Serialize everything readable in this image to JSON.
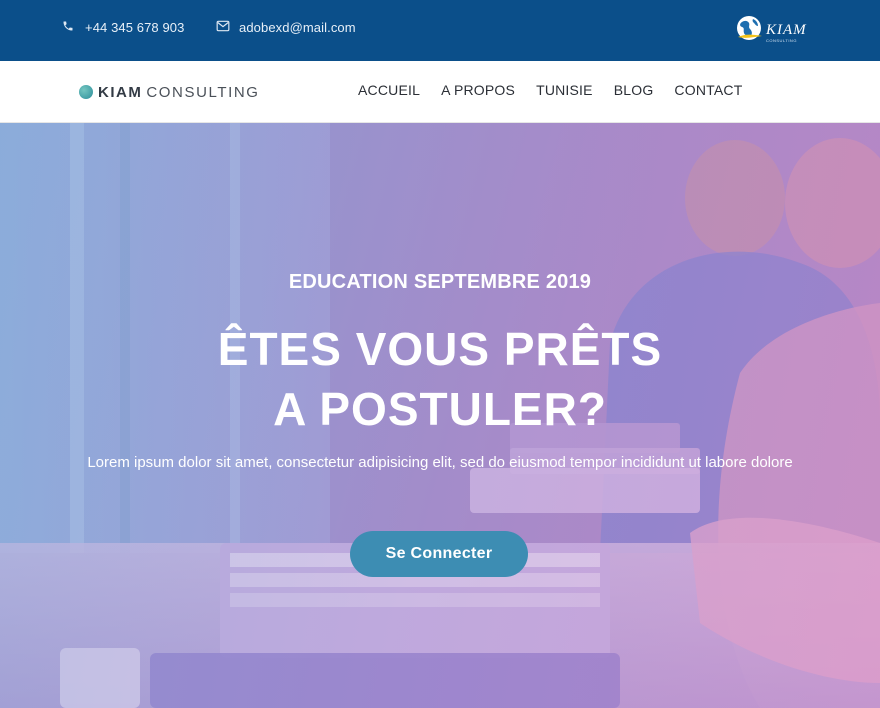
{
  "topbar": {
    "phone": "+44 345 678 903",
    "email": "adobexd@mail.com",
    "badge_text": "KIAM",
    "badge_sub": "CONSULTING",
    "background": "#0b4f8a"
  },
  "navbar": {
    "logo_strong": "KIAM",
    "logo_light": "CONSULTING",
    "menu": [
      {
        "label": "ACCUEIL"
      },
      {
        "label": "A PROPOS"
      },
      {
        "label": "TUNISIE"
      },
      {
        "label": "BLOG"
      },
      {
        "label": "CONTACT"
      }
    ]
  },
  "hero": {
    "kicker": "EDUCATION SEPTEMBRE 2019",
    "title_line1": "ÊTES VOUS PRÊTS",
    "title_line2": "A POSTULER?",
    "text": "Lorem ipsum dolor sit amet, consectetur adipisicing elit, sed do eiusmod tempor incididunt ut labore dolore",
    "cta_label": "Se Connecter",
    "cta_color": "#3d8db3"
  },
  "icons": {
    "phone": "phone-icon",
    "email": "envelope-icon",
    "badge": "globe-logo-icon",
    "logo": "logo-dot-icon"
  }
}
